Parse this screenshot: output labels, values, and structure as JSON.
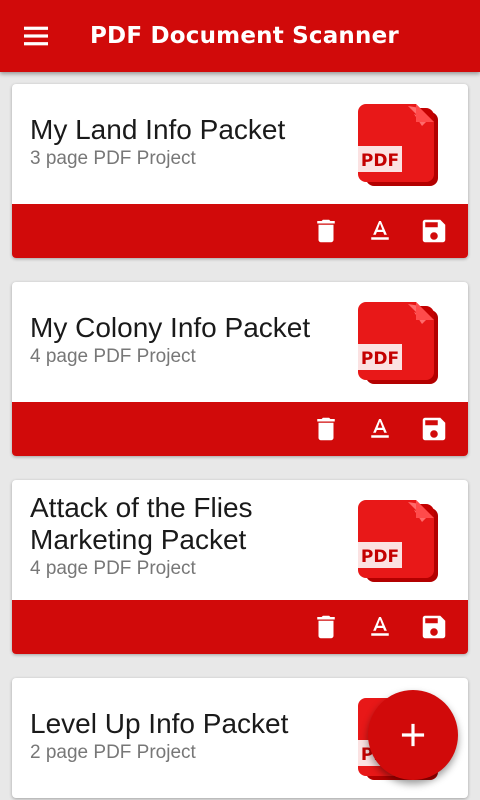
{
  "app": {
    "title": "PDF Document Scanner"
  },
  "colors": {
    "primary": "#d10a0a"
  },
  "icons": {
    "menu": "hamburger-icon",
    "delete": "trash-icon",
    "rename": "text-format-icon",
    "save": "floppy-disk-icon",
    "add": "plus-icon"
  },
  "projects": [
    {
      "title": "My Land Info Packet",
      "subtitle": "3 page PDF Project",
      "badge": "PDF"
    },
    {
      "title": "My Colony Info Packet",
      "subtitle": "4 page PDF Project",
      "badge": "PDF"
    },
    {
      "title": "Attack of the Flies Marketing Packet",
      "subtitle": "4 page PDF Project",
      "badge": "PDF"
    },
    {
      "title": "Level Up Info Packet",
      "subtitle": "2 page PDF Project",
      "badge": "PDF"
    }
  ]
}
